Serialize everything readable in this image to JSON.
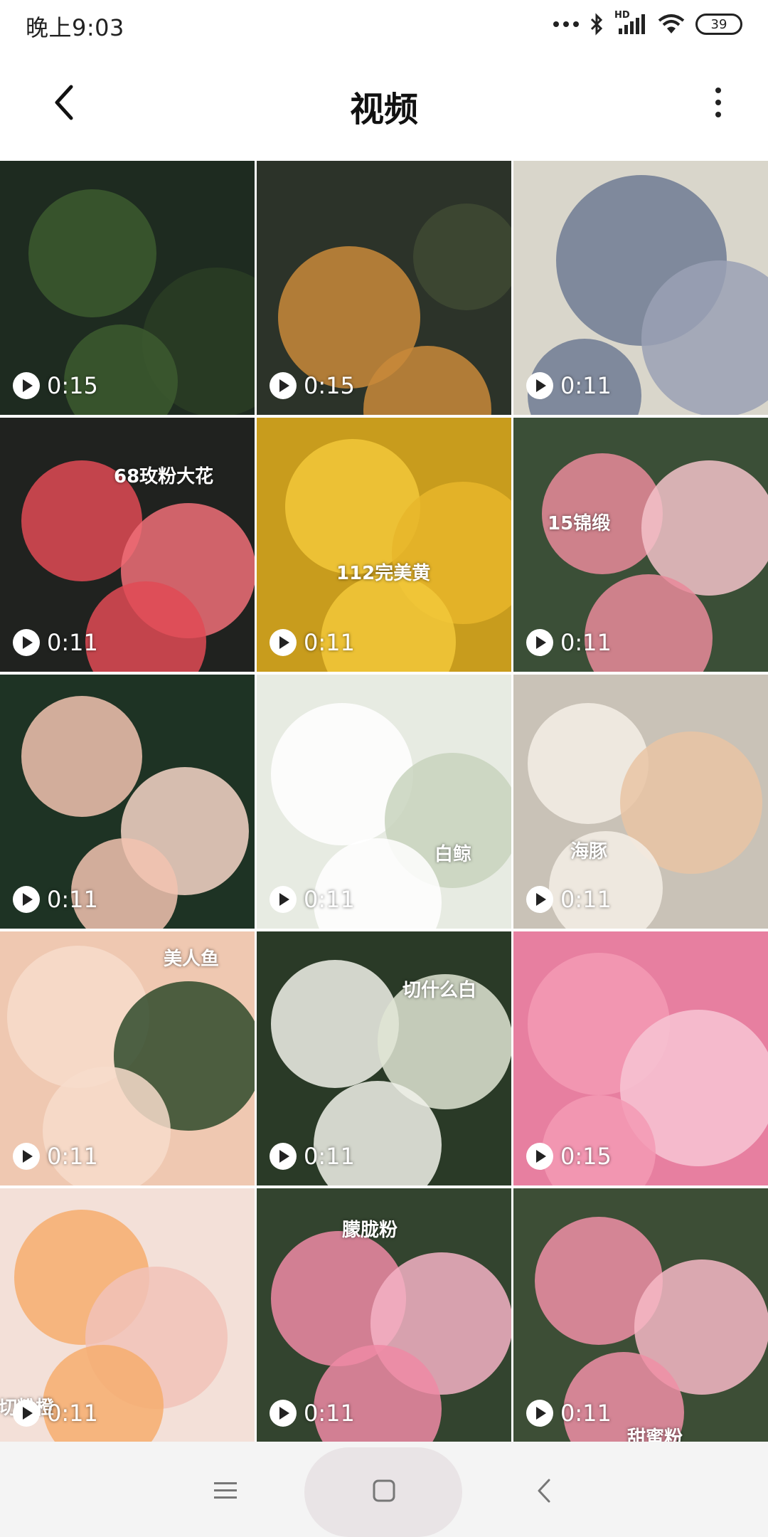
{
  "status_bar": {
    "time": "晚上9:03",
    "battery_level": "39",
    "network_label": "HD"
  },
  "app_bar": {
    "title": "视频"
  },
  "videos": [
    {
      "label": "",
      "duration": "0:15",
      "colors": [
        "#1e2b20",
        "#3c5a2f",
        "#2a3d25"
      ]
    },
    {
      "label": "",
      "duration": "0:15",
      "colors": [
        "#2c3329",
        "#c98a3a",
        "#3f4a33"
      ]
    },
    {
      "label": "",
      "duration": "0:11",
      "colors": [
        "#d9d6cb",
        "#6f7b94",
        "#9aa1b5"
      ]
    },
    {
      "label": "68玫粉大花",
      "duration": "0:11",
      "colors": [
        "#20221f",
        "#e04a55",
        "#f06e78"
      ]
    },
    {
      "label": "112完美黄",
      "duration": "0:11",
      "colors": [
        "#c89c1d",
        "#f2c83a",
        "#e7b62a"
      ]
    },
    {
      "label": "15锦缎",
      "duration": "0:11",
      "colors": [
        "#3b4f37",
        "#e98a9a",
        "#f3c2c9"
      ]
    },
    {
      "label": "",
      "duration": "0:11",
      "colors": [
        "#1e3324",
        "#f2c3b0",
        "#f7d6c8"
      ]
    },
    {
      "label": "白鲸",
      "duration": "0:11",
      "colors": [
        "#e7ebe2",
        "#ffffff",
        "#c8d3bd"
      ]
    },
    {
      "label": "海豚",
      "duration": "0:11",
      "colors": [
        "#c9c2b7",
        "#f4efe6",
        "#e9c4a4"
      ]
    },
    {
      "label": "美人鱼",
      "duration": "0:11",
      "colors": [
        "#efc8b1",
        "#f7dccb",
        "#2f4a2c"
      ]
    },
    {
      "label": "切什么白",
      "duration": "0:11",
      "colors": [
        "#2a3a27",
        "#f1f2ea",
        "#dfe5d3"
      ]
    },
    {
      "label": "",
      "duration": "0:15",
      "colors": [
        "#e77fa0",
        "#f39ab4",
        "#f7c4d3"
      ]
    },
    {
      "label": "切粉橙",
      "duration": "0:11",
      "colors": [
        "#f3e0d8",
        "#f6ad6e",
        "#f1c2b8"
      ]
    },
    {
      "label": "朦胧粉",
      "duration": "0:11",
      "colors": [
        "#33442f",
        "#ee8aa4",
        "#f4b2c4"
      ]
    },
    {
      "label": "甜蜜粉",
      "duration": "0:11",
      "colors": [
        "#3d4e36",
        "#ef8fa6",
        "#f6b8c6"
      ]
    }
  ],
  "nav_bar": {
    "menu_icon": "menu-icon",
    "home_icon": "home-icon",
    "back_icon": "back-icon"
  }
}
